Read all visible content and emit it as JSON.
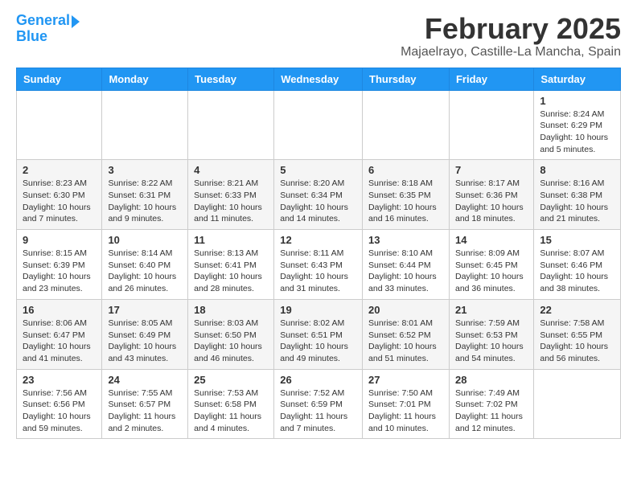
{
  "logo": {
    "line1": "General",
    "line2": "Blue"
  },
  "header": {
    "month": "February 2025",
    "location": "Majaelrayo, Castille-La Mancha, Spain"
  },
  "weekdays": [
    "Sunday",
    "Monday",
    "Tuesday",
    "Wednesday",
    "Thursday",
    "Friday",
    "Saturday"
  ],
  "weeks": [
    [
      {
        "day": "",
        "info": ""
      },
      {
        "day": "",
        "info": ""
      },
      {
        "day": "",
        "info": ""
      },
      {
        "day": "",
        "info": ""
      },
      {
        "day": "",
        "info": ""
      },
      {
        "day": "",
        "info": ""
      },
      {
        "day": "1",
        "info": "Sunrise: 8:24 AM\nSunset: 6:29 PM\nDaylight: 10 hours\nand 5 minutes."
      }
    ],
    [
      {
        "day": "2",
        "info": "Sunrise: 8:23 AM\nSunset: 6:30 PM\nDaylight: 10 hours\nand 7 minutes."
      },
      {
        "day": "3",
        "info": "Sunrise: 8:22 AM\nSunset: 6:31 PM\nDaylight: 10 hours\nand 9 minutes."
      },
      {
        "day": "4",
        "info": "Sunrise: 8:21 AM\nSunset: 6:33 PM\nDaylight: 10 hours\nand 11 minutes."
      },
      {
        "day": "5",
        "info": "Sunrise: 8:20 AM\nSunset: 6:34 PM\nDaylight: 10 hours\nand 14 minutes."
      },
      {
        "day": "6",
        "info": "Sunrise: 8:18 AM\nSunset: 6:35 PM\nDaylight: 10 hours\nand 16 minutes."
      },
      {
        "day": "7",
        "info": "Sunrise: 8:17 AM\nSunset: 6:36 PM\nDaylight: 10 hours\nand 18 minutes."
      },
      {
        "day": "8",
        "info": "Sunrise: 8:16 AM\nSunset: 6:38 PM\nDaylight: 10 hours\nand 21 minutes."
      }
    ],
    [
      {
        "day": "9",
        "info": "Sunrise: 8:15 AM\nSunset: 6:39 PM\nDaylight: 10 hours\nand 23 minutes."
      },
      {
        "day": "10",
        "info": "Sunrise: 8:14 AM\nSunset: 6:40 PM\nDaylight: 10 hours\nand 26 minutes."
      },
      {
        "day": "11",
        "info": "Sunrise: 8:13 AM\nSunset: 6:41 PM\nDaylight: 10 hours\nand 28 minutes."
      },
      {
        "day": "12",
        "info": "Sunrise: 8:11 AM\nSunset: 6:43 PM\nDaylight: 10 hours\nand 31 minutes."
      },
      {
        "day": "13",
        "info": "Sunrise: 8:10 AM\nSunset: 6:44 PM\nDaylight: 10 hours\nand 33 minutes."
      },
      {
        "day": "14",
        "info": "Sunrise: 8:09 AM\nSunset: 6:45 PM\nDaylight: 10 hours\nand 36 minutes."
      },
      {
        "day": "15",
        "info": "Sunrise: 8:07 AM\nSunset: 6:46 PM\nDaylight: 10 hours\nand 38 minutes."
      }
    ],
    [
      {
        "day": "16",
        "info": "Sunrise: 8:06 AM\nSunset: 6:47 PM\nDaylight: 10 hours\nand 41 minutes."
      },
      {
        "day": "17",
        "info": "Sunrise: 8:05 AM\nSunset: 6:49 PM\nDaylight: 10 hours\nand 43 minutes."
      },
      {
        "day": "18",
        "info": "Sunrise: 8:03 AM\nSunset: 6:50 PM\nDaylight: 10 hours\nand 46 minutes."
      },
      {
        "day": "19",
        "info": "Sunrise: 8:02 AM\nSunset: 6:51 PM\nDaylight: 10 hours\nand 49 minutes."
      },
      {
        "day": "20",
        "info": "Sunrise: 8:01 AM\nSunset: 6:52 PM\nDaylight: 10 hours\nand 51 minutes."
      },
      {
        "day": "21",
        "info": "Sunrise: 7:59 AM\nSunset: 6:53 PM\nDaylight: 10 hours\nand 54 minutes."
      },
      {
        "day": "22",
        "info": "Sunrise: 7:58 AM\nSunset: 6:55 PM\nDaylight: 10 hours\nand 56 minutes."
      }
    ],
    [
      {
        "day": "23",
        "info": "Sunrise: 7:56 AM\nSunset: 6:56 PM\nDaylight: 10 hours\nand 59 minutes."
      },
      {
        "day": "24",
        "info": "Sunrise: 7:55 AM\nSunset: 6:57 PM\nDaylight: 11 hours\nand 2 minutes."
      },
      {
        "day": "25",
        "info": "Sunrise: 7:53 AM\nSunset: 6:58 PM\nDaylight: 11 hours\nand 4 minutes."
      },
      {
        "day": "26",
        "info": "Sunrise: 7:52 AM\nSunset: 6:59 PM\nDaylight: 11 hours\nand 7 minutes."
      },
      {
        "day": "27",
        "info": "Sunrise: 7:50 AM\nSunset: 7:01 PM\nDaylight: 11 hours\nand 10 minutes."
      },
      {
        "day": "28",
        "info": "Sunrise: 7:49 AM\nSunset: 7:02 PM\nDaylight: 11 hours\nand 12 minutes."
      },
      {
        "day": "",
        "info": ""
      }
    ]
  ]
}
